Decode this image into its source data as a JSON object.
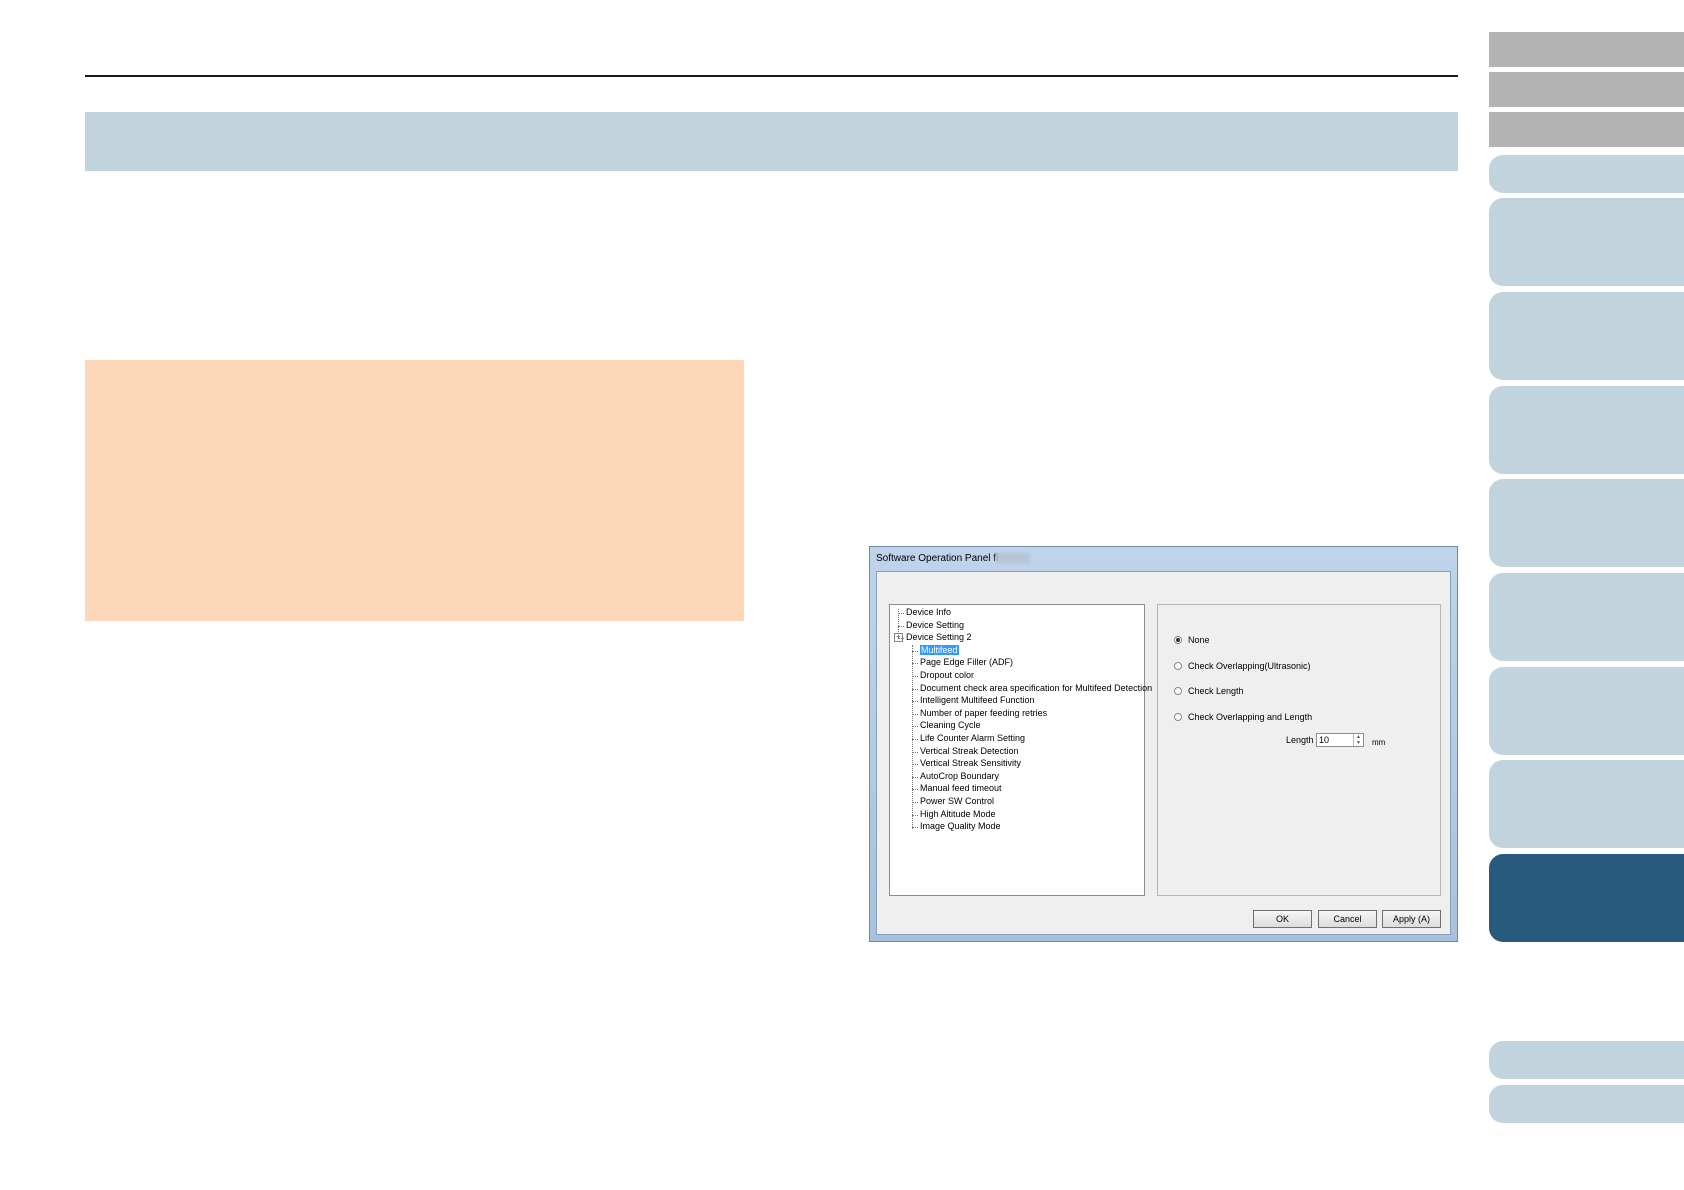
{
  "dialog": {
    "title": "Software Operation Panel fi-",
    "tree": [
      {
        "label": "Device Info",
        "level": 0
      },
      {
        "label": "Device Setting",
        "level": 0
      },
      {
        "label": "Device Setting 2",
        "level": 0
      },
      {
        "label": "Multifeed",
        "level": 1,
        "selected": true
      },
      {
        "label": "Page Edge Filler (ADF)",
        "level": 1
      },
      {
        "label": "Dropout color",
        "level": 1
      },
      {
        "label": "Document check area specification for Multifeed Detection",
        "level": 1
      },
      {
        "label": "Intelligent Multifeed Function",
        "level": 1
      },
      {
        "label": "Number of paper feeding retries",
        "level": 1
      },
      {
        "label": "Cleaning Cycle",
        "level": 1
      },
      {
        "label": "Life Counter Alarm Setting",
        "level": 1
      },
      {
        "label": "Vertical Streak Detection",
        "level": 1
      },
      {
        "label": "Vertical Streak Sensitivity",
        "level": 1
      },
      {
        "label": "AutoCrop Boundary",
        "level": 1
      },
      {
        "label": "Manual feed timeout",
        "level": 1
      },
      {
        "label": "Power SW Control",
        "level": 1
      },
      {
        "label": "High Altitude Mode",
        "level": 1
      },
      {
        "label": "Image Quality Mode",
        "level": 1
      }
    ],
    "options": {
      "radios": [
        "None",
        "Check Overlapping(Ultrasonic)",
        "Check Length",
        "Check Overlapping and Length"
      ],
      "selected": "None",
      "length_label": "Length",
      "length_value": "10",
      "length_unit": "mm"
    },
    "buttons": {
      "ok": "OK",
      "cancel": "Cancel",
      "apply": "Apply (A)"
    }
  }
}
